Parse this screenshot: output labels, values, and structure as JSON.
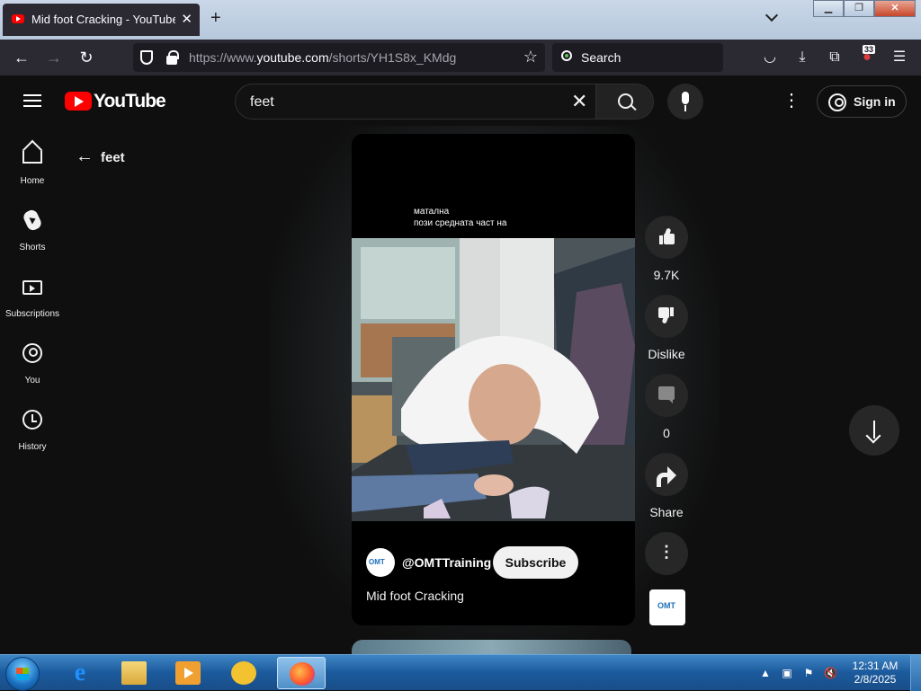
{
  "browser": {
    "tab_title": "Mid foot Cracking - YouTube",
    "new_tab": "+",
    "url_prefix": "https://www.",
    "url_domain": "youtube.com",
    "url_path": "/shorts/YH1S8x_KMdg",
    "search_placeholder": "Search",
    "extension_badge": "33"
  },
  "youtube": {
    "logo_text": "YouTube",
    "search_value": "feet",
    "signin_label": "Sign in",
    "sidebar": [
      {
        "label": "Home",
        "icon": "home-icon"
      },
      {
        "label": "Shorts",
        "icon": "shorts-icon"
      },
      {
        "label": "Subscriptions",
        "icon": "subscriptions-icon"
      },
      {
        "label": "You",
        "icon": "you-icon"
      },
      {
        "label": "History",
        "icon": "history-icon"
      }
    ],
    "back_label": "feet",
    "short": {
      "caption_line1": "матална",
      "caption_line2": "пози средната част на",
      "channel": "@OMTTraining",
      "subscribe_label": "Subscribe",
      "title": "Mid foot Cracking",
      "likes": "9.7K",
      "dislike_label": "Dislike",
      "comments": "0",
      "share_label": "Share"
    }
  },
  "taskbar": {
    "clock_time": "12:31 AM",
    "clock_date": "2/8/2025"
  },
  "colors": {
    "yt_red": "#ff0000",
    "yt_bg": "#0f0f0f",
    "firefox_toolbar": "#2b2a33",
    "taskbar_blue": "#1b5a9c"
  }
}
